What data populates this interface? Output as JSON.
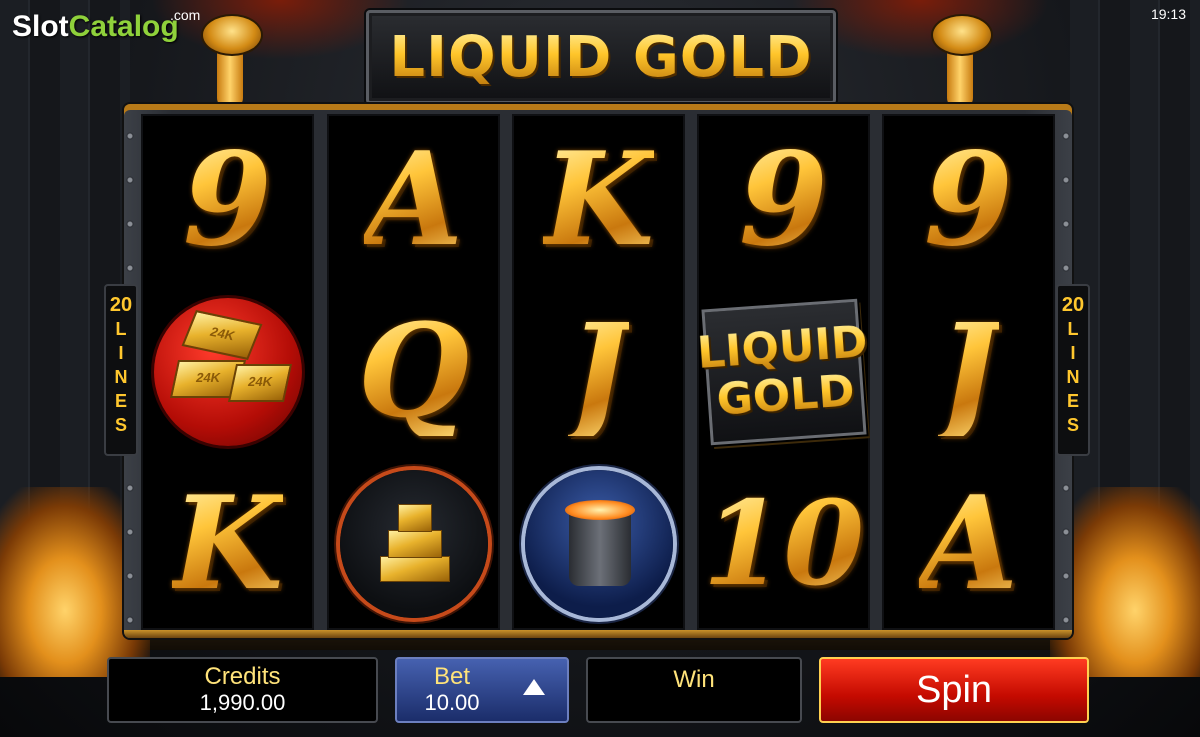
{
  "brand": {
    "slot": "Slot",
    "catalog": "Catalog",
    "com": ".com"
  },
  "status": {
    "time": "19:13"
  },
  "game": {
    "title": "LIQUID GOLD"
  },
  "lines": {
    "count": "20",
    "word": "LINES"
  },
  "reels": [
    [
      "9",
      "gold-bars",
      "K"
    ],
    [
      "A",
      "Q",
      "gold-ingots"
    ],
    [
      "K",
      "J",
      "molten-ladle"
    ],
    [
      "9",
      "liquid-gold-wild",
      "10"
    ],
    [
      "9",
      "J",
      "A"
    ]
  ],
  "symbols": {
    "bar_mark": "24K",
    "wild_line1": "LIQUID",
    "wild_line2": "GOLD"
  },
  "controls": {
    "credits_label": "Credits",
    "credits_value": "1,990.00",
    "bet_label": "Bet",
    "bet_value": "10.00",
    "win_label": "Win",
    "spin_label": "Spin"
  },
  "colors": {
    "gold": "#ffc72e",
    "spin_red": "#d81200",
    "bet_blue": "#2c4290",
    "brand_green": "#8fd13b"
  }
}
